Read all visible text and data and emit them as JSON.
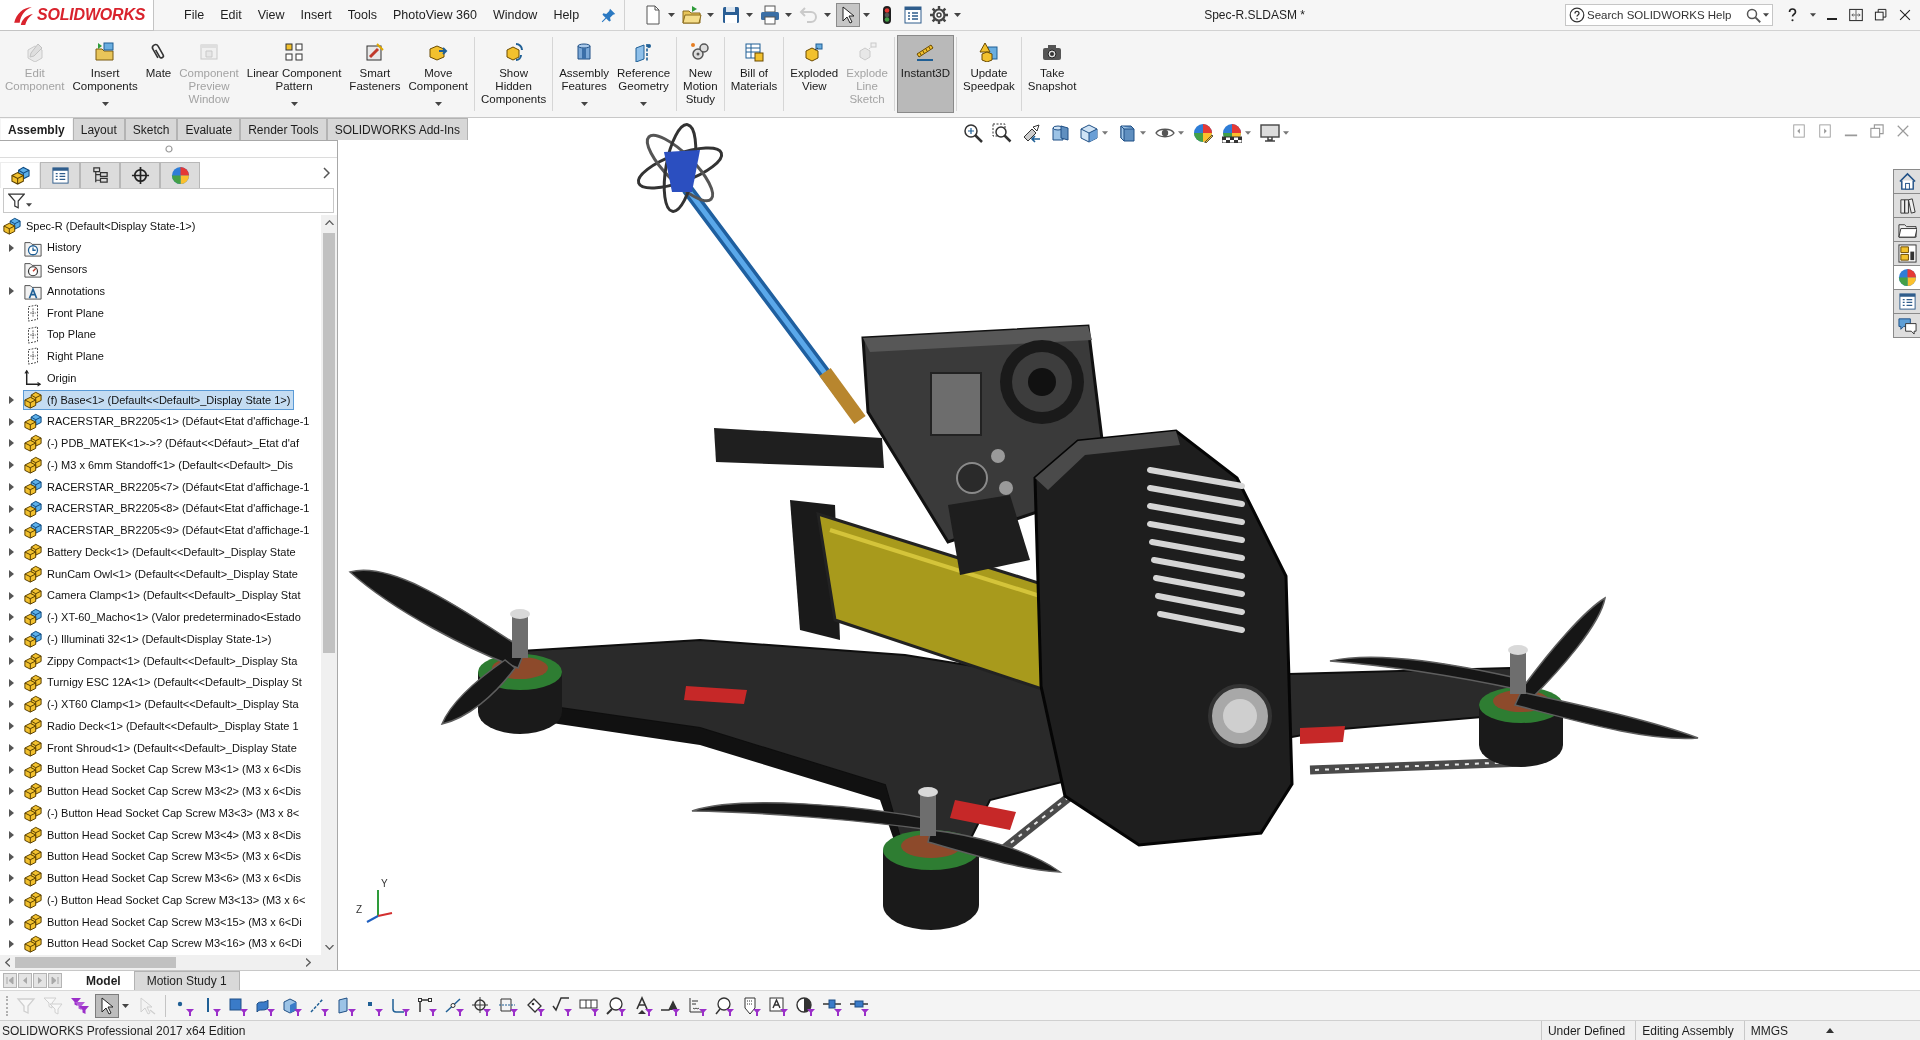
{
  "app": {
    "logo": "SOLIDWORKS",
    "title": "Spec-R.SLDASM *"
  },
  "menu": [
    "File",
    "Edit",
    "View",
    "Insert",
    "Tools",
    "PhotoView 360",
    "Window",
    "Help"
  ],
  "quick_access": [
    {
      "kind": "new",
      "disabled": false,
      "pressed": false,
      "dropdown": true
    },
    {
      "kind": "open",
      "disabled": false,
      "pressed": false,
      "dropdown": true
    },
    {
      "kind": "save",
      "disabled": false,
      "pressed": false,
      "dropdown": true
    },
    {
      "kind": "print",
      "disabled": false,
      "pressed": false,
      "dropdown": true
    },
    {
      "kind": "undo",
      "disabled": true,
      "pressed": false,
      "dropdown": true
    },
    {
      "kind": "select",
      "disabled": false,
      "pressed": true,
      "dropdown": true
    },
    {
      "kind": "rebuild",
      "disabled": false,
      "pressed": false,
      "dropdown": false
    },
    {
      "kind": "properties",
      "disabled": false,
      "pressed": false,
      "dropdown": false
    },
    {
      "kind": "options",
      "disabled": false,
      "pressed": false,
      "dropdown": true
    }
  ],
  "help_search": {
    "placeholder": "Search SOLIDWORKS Help"
  },
  "ribbon": {
    "groups": [
      {
        "buttons": [
          {
            "kind": "edit-component",
            "label": "Edit\nComponent",
            "disabled": true,
            "pressed": false,
            "dropdown": false
          },
          {
            "kind": "insert-components",
            "label": "Insert\nComponents",
            "disabled": false,
            "pressed": false,
            "dropdown": true
          },
          {
            "kind": "mate",
            "label": "Mate",
            "disabled": false,
            "pressed": false,
            "dropdown": false
          },
          {
            "kind": "component-preview",
            "label": "Component\nPreview\nWindow",
            "disabled": true,
            "pressed": false,
            "dropdown": false
          },
          {
            "kind": "linear-pattern",
            "label": "Linear Component\nPattern",
            "disabled": false,
            "pressed": false,
            "dropdown": true
          },
          {
            "kind": "smart-fasteners",
            "label": "Smart\nFasteners",
            "disabled": false,
            "pressed": false,
            "dropdown": false
          },
          {
            "kind": "move-component",
            "label": "Move\nComponent",
            "disabled": false,
            "pressed": false,
            "dropdown": true
          }
        ]
      },
      {
        "buttons": [
          {
            "kind": "show-hidden",
            "label": "Show\nHidden\nComponents",
            "disabled": false,
            "pressed": false,
            "dropdown": false
          }
        ]
      },
      {
        "buttons": [
          {
            "kind": "assembly-features",
            "label": "Assembly\nFeatures",
            "disabled": false,
            "pressed": false,
            "dropdown": true
          },
          {
            "kind": "reference-geometry",
            "label": "Reference\nGeometry",
            "disabled": false,
            "pressed": false,
            "dropdown": true
          }
        ]
      },
      {
        "buttons": [
          {
            "kind": "motion-study",
            "label": "New\nMotion\nStudy",
            "disabled": false,
            "pressed": false,
            "dropdown": false
          }
        ]
      },
      {
        "buttons": [
          {
            "kind": "bill-of-materials",
            "label": "Bill of\nMaterials",
            "disabled": false,
            "pressed": false,
            "dropdown": false
          }
        ]
      },
      {
        "buttons": [
          {
            "kind": "exploded-view",
            "label": "Exploded\nView",
            "disabled": false,
            "pressed": false,
            "dropdown": false
          },
          {
            "kind": "explode-line",
            "label": "Explode\nLine\nSketch",
            "disabled": true,
            "pressed": false,
            "dropdown": false
          }
        ]
      },
      {
        "buttons": [
          {
            "kind": "instant3d",
            "label": "Instant3D",
            "disabled": false,
            "pressed": true,
            "dropdown": false
          }
        ]
      },
      {
        "buttons": [
          {
            "kind": "speedpak",
            "label": "Update\nSpeedpak",
            "disabled": false,
            "pressed": false,
            "dropdown": false
          }
        ]
      },
      {
        "buttons": [
          {
            "kind": "snapshot",
            "label": "Take\nSnapshot",
            "disabled": false,
            "pressed": false,
            "dropdown": false
          }
        ]
      }
    ]
  },
  "command_tabs": [
    {
      "label": "Assembly",
      "selected": true
    },
    {
      "label": "Layout",
      "selected": false
    },
    {
      "label": "Sketch",
      "selected": false
    },
    {
      "label": "Evaluate",
      "selected": false
    },
    {
      "label": "Render Tools",
      "selected": false
    },
    {
      "label": "SOLIDWORKS Add-Ins",
      "selected": false
    }
  ],
  "panel_tabs": [
    {
      "kind": "feature-tree",
      "selected": true
    },
    {
      "kind": "property-manager",
      "selected": false
    },
    {
      "kind": "configuration-manager",
      "selected": false
    },
    {
      "kind": "dimxpert",
      "selected": false
    },
    {
      "kind": "display-manager",
      "selected": false
    }
  ],
  "feature_tree": {
    "label": "Spec-R (Default<Display State-1>)",
    "kind": "assembly",
    "expandable": false,
    "selected": false,
    "children": [
      {
        "label": "History",
        "kind": "history",
        "expandable": true,
        "selected": false
      },
      {
        "label": "Sensors",
        "kind": "sensors",
        "expandable": false,
        "selected": false
      },
      {
        "label": "Annotations",
        "kind": "annotations",
        "expandable": true,
        "selected": false
      },
      {
        "label": "Front Plane",
        "kind": "plane",
        "expandable": false,
        "selected": false
      },
      {
        "label": "Top Plane",
        "kind": "plane",
        "expandable": false,
        "selected": false
      },
      {
        "label": "Right Plane",
        "kind": "plane",
        "expandable": false,
        "selected": false
      },
      {
        "label": "Origin",
        "kind": "origin",
        "expandable": false,
        "selected": false
      },
      {
        "label": "(f) Base<1> (Default<<Default>_Display State 1>)",
        "kind": "part",
        "expandable": true,
        "selected": true
      },
      {
        "label": "RACERSTAR_BR2205<1> (Défaut<Etat d'affichage-1",
        "kind": "assembly",
        "expandable": true,
        "selected": false
      },
      {
        "label": "(-) PDB_MATEK<1>->? (Défaut<<Défaut>_Etat d'af",
        "kind": "part",
        "expandable": true,
        "selected": false
      },
      {
        "label": "(-) M3 x 6mm Standoff<1> (Default<<Default>_Dis",
        "kind": "part",
        "expandable": true,
        "selected": false
      },
      {
        "label": "RACERSTAR_BR2205<7> (Défaut<Etat d'affichage-1",
        "kind": "assembly",
        "expandable": true,
        "selected": false
      },
      {
        "label": "RACERSTAR_BR2205<8> (Défaut<Etat d'affichage-1",
        "kind": "assembly",
        "expandable": true,
        "selected": false
      },
      {
        "label": "RACERSTAR_BR2205<9> (Défaut<Etat d'affichage-1",
        "kind": "assembly",
        "expandable": true,
        "selected": false
      },
      {
        "label": "Battery Deck<1> (Default<<Default>_Display State",
        "kind": "part",
        "expandable": true,
        "selected": false
      },
      {
        "label": "RunCam Owl<1> (Default<<Default>_Display State",
        "kind": "part",
        "expandable": true,
        "selected": false
      },
      {
        "label": "Camera Clamp<1> (Default<<Default>_Display Stat",
        "kind": "part",
        "expandable": true,
        "selected": false
      },
      {
        "label": "(-) XT-60_Macho<1> (Valor predeterminado<Estado",
        "kind": "assembly",
        "expandable": true,
        "selected": false
      },
      {
        "label": "(-) Illuminati 32<1> (Default<Display State-1>)",
        "kind": "assembly",
        "expandable": true,
        "selected": false
      },
      {
        "label": "Zippy Compact<1> (Default<<Default>_Display Sta",
        "kind": "part",
        "expandable": true,
        "selected": false
      },
      {
        "label": "Turnigy ESC 12A<1> (Default<<Default>_Display St",
        "kind": "part",
        "expandable": true,
        "selected": false
      },
      {
        "label": "(-) XT60 Clamp<1> (Default<<Default>_Display Sta",
        "kind": "part",
        "expandable": true,
        "selected": false
      },
      {
        "label": "Radio Deck<1> (Default<<Default>_Display State 1",
        "kind": "part",
        "expandable": true,
        "selected": false
      },
      {
        "label": "Front Shroud<1> (Default<<Default>_Display State",
        "kind": "part",
        "expandable": true,
        "selected": false
      },
      {
        "label": "Button Head Socket Cap Screw M3<1> (M3 x 6<Dis",
        "kind": "part",
        "expandable": true,
        "selected": false
      },
      {
        "label": "Button Head Socket Cap Screw M3<2> (M3 x 6<Dis",
        "kind": "part",
        "expandable": true,
        "selected": false
      },
      {
        "label": "(-) Button Head Socket Cap Screw M3<3> (M3 x 8<",
        "kind": "part",
        "expandable": true,
        "selected": false
      },
      {
        "label": "Button Head Socket Cap Screw M3<4> (M3 x 8<Dis",
        "kind": "part",
        "expandable": true,
        "selected": false
      },
      {
        "label": "Button Head Socket Cap Screw M3<5> (M3 x 6<Dis",
        "kind": "part",
        "expandable": true,
        "selected": false
      },
      {
        "label": "Button Head Socket Cap Screw M3<6> (M3 x 6<Dis",
        "kind": "part",
        "expandable": true,
        "selected": false
      },
      {
        "label": "(-) Button Head Socket Cap Screw M3<13> (M3 x 6<",
        "kind": "part",
        "expandable": true,
        "selected": false
      },
      {
        "label": "Button Head Socket Cap Screw M3<15> (M3 x 6<Di",
        "kind": "part",
        "expandable": true,
        "selected": false
      },
      {
        "label": "Button Head Socket Cap Screw M3<16> (M3 x 6<Di",
        "kind": "part",
        "expandable": true,
        "selected": false
      }
    ]
  },
  "task_pane": [
    {
      "kind": "home",
      "selected": false
    },
    {
      "kind": "design-library",
      "selected": false
    },
    {
      "kind": "file-explorer",
      "selected": false
    },
    {
      "kind": "view-palette",
      "selected": false
    },
    {
      "kind": "appearances",
      "selected": true
    },
    {
      "kind": "custom-properties",
      "selected": false
    },
    {
      "kind": "forum",
      "selected": false
    }
  ],
  "triad_labels": [
    "Y",
    "Z"
  ],
  "bottom_tabs": [
    {
      "label": "Model",
      "selected": true
    },
    {
      "label": "Motion Study 1",
      "selected": false
    }
  ],
  "selection_filter": {
    "groups": [
      [
        {
          "kind": "toggle-filter",
          "disabled": true,
          "pressed": false,
          "dropdown": false
        },
        {
          "kind": "filter-toolbar",
          "disabled": true,
          "pressed": false,
          "dropdown": false
        },
        {
          "kind": "clear-filters",
          "disabled": false,
          "pressed": false,
          "dropdown": false
        },
        {
          "kind": "select",
          "disabled": false,
          "pressed": true,
          "dropdown": true
        },
        {
          "kind": "select-other",
          "disabled": true,
          "pressed": false,
          "dropdown": false
        }
      ],
      [
        {
          "kind": "vertex",
          "disabled": false,
          "pressed": false,
          "dropdown": false
        },
        {
          "kind": "edge",
          "disabled": false,
          "pressed": false,
          "dropdown": false
        },
        {
          "kind": "face",
          "disabled": false,
          "pressed": false,
          "dropdown": false
        },
        {
          "kind": "surface",
          "disabled": false,
          "pressed": false,
          "dropdown": false
        },
        {
          "kind": "solid",
          "disabled": false,
          "pressed": false,
          "dropdown": false
        },
        {
          "kind": "axis",
          "disabled": false,
          "pressed": false,
          "dropdown": false
        },
        {
          "kind": "plane",
          "disabled": false,
          "pressed": false,
          "dropdown": false
        },
        {
          "kind": "point",
          "disabled": false,
          "pressed": false,
          "dropdown": false
        },
        {
          "kind": "sketch-segment",
          "disabled": false,
          "pressed": false,
          "dropdown": false
        },
        {
          "kind": "sketch-line",
          "disabled": false,
          "pressed": false,
          "dropdown": false
        },
        {
          "kind": "line-point",
          "disabled": false,
          "pressed": false,
          "dropdown": false
        },
        {
          "kind": "center-mark",
          "disabled": false,
          "pressed": false,
          "dropdown": false
        },
        {
          "kind": "dimension",
          "disabled": false,
          "pressed": false,
          "dropdown": false
        },
        {
          "kind": "tag",
          "disabled": false,
          "pressed": false,
          "dropdown": false
        },
        {
          "kind": "surface-finish",
          "disabled": false,
          "pressed": false,
          "dropdown": false
        },
        {
          "kind": "gtol",
          "disabled": false,
          "pressed": false,
          "dropdown": false
        },
        {
          "kind": "note",
          "disabled": false,
          "pressed": false,
          "dropdown": false
        },
        {
          "kind": "datum",
          "disabled": false,
          "pressed": false,
          "dropdown": false
        },
        {
          "kind": "weld",
          "disabled": false,
          "pressed": false,
          "dropdown": false
        },
        {
          "kind": "step",
          "disabled": false,
          "pressed": false,
          "dropdown": false
        },
        {
          "kind": "balloon",
          "disabled": false,
          "pressed": false,
          "dropdown": false
        },
        {
          "kind": "thread",
          "disabled": false,
          "pressed": false,
          "dropdown": false
        },
        {
          "kind": "text-box",
          "disabled": false,
          "pressed": false,
          "dropdown": false
        },
        {
          "kind": "half-circle",
          "disabled": false,
          "pressed": false,
          "dropdown": false
        },
        {
          "kind": "connector",
          "disabled": false,
          "pressed": false,
          "dropdown": false
        },
        {
          "kind": "block-line",
          "disabled": false,
          "pressed": false,
          "dropdown": false
        }
      ]
    ]
  },
  "status_bar": {
    "edition": "SOLIDWORKS Professional 2017 x64 Edition",
    "fields": [
      "Under Defined",
      "Editing Assembly",
      "MMGS"
    ]
  }
}
